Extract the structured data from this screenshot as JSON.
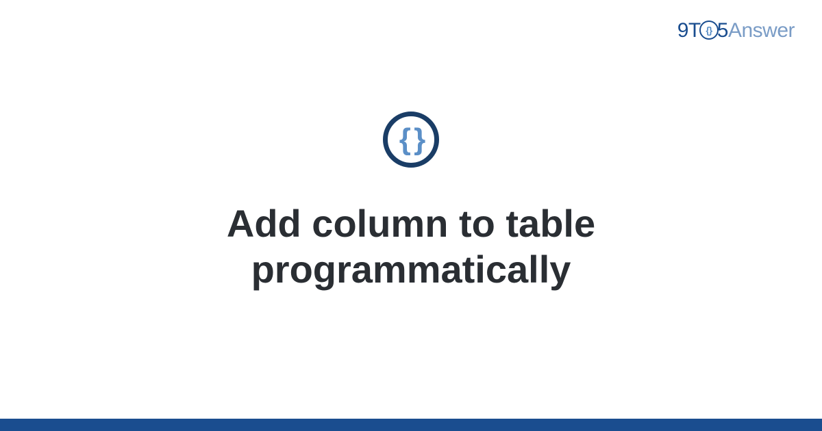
{
  "logo": {
    "part1": "9T",
    "circle_inner": "{}",
    "part2": "5",
    "part3": "Answer"
  },
  "icon": {
    "braces": "{ }"
  },
  "title": "Add column to table programmatically"
}
